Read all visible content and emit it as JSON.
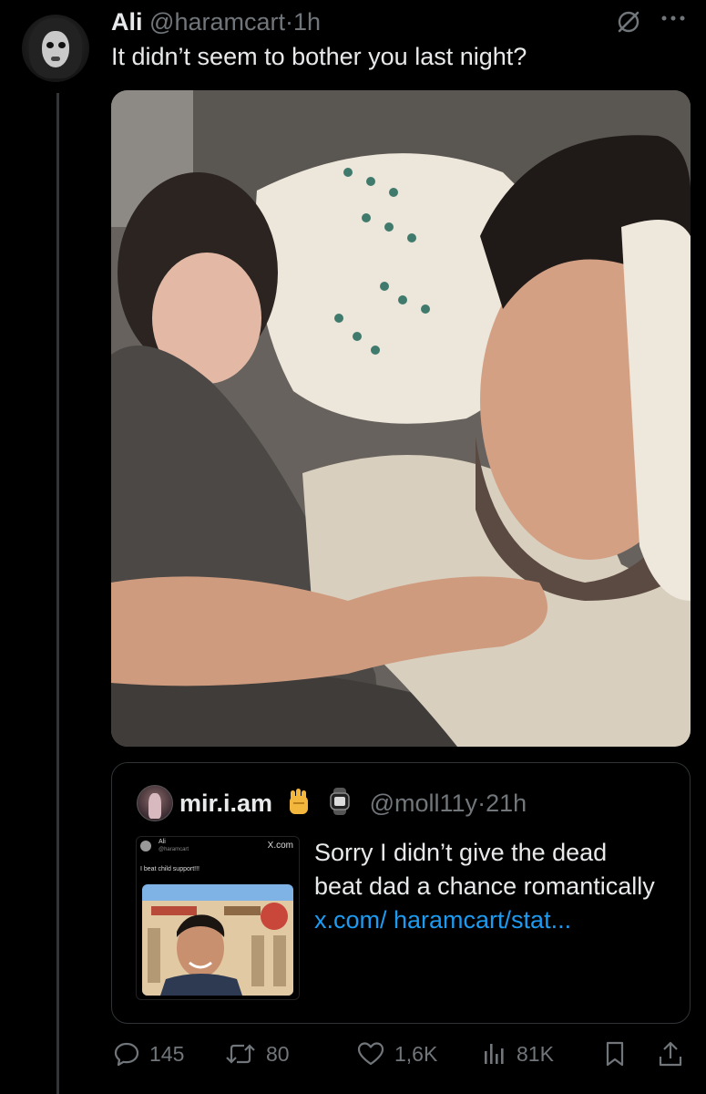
{
  "post": {
    "author_name": "Ali",
    "author_handle": "@haramcart",
    "separator": "·",
    "time": "1h",
    "text": "It didn’t seem to bother you last night?"
  },
  "quoted_post": {
    "author_name": "mir.i.am",
    "author_handle": "@moll11y",
    "separator": "·",
    "time": "21h",
    "text_plain": "Sorry I didn’t give the dead beat dad a chance romantically ",
    "text_link": "x.com/ haramcart/stat...",
    "embedded_screenshot": {
      "name": "Ali",
      "handle": "@haramcart",
      "source": "X.com",
      "text": "I beat child support!!!"
    }
  },
  "actions": {
    "replies": "145",
    "reposts": "80",
    "likes": "1,6K",
    "views": "81K"
  },
  "icons": {
    "header": [
      "grok-icon",
      "more-icon"
    ],
    "actions": [
      "reply-icon",
      "repost-icon",
      "like-icon",
      "views-icon",
      "bookmark-icon",
      "share-icon"
    ],
    "quote_badges": [
      "raised-fist-emoji",
      "watch-emoji"
    ]
  },
  "colors": {
    "background": "#000000",
    "text": "#e7e9ea",
    "secondary_text": "#71767b",
    "link": "#1d9bf0",
    "border": "#2f3336"
  }
}
